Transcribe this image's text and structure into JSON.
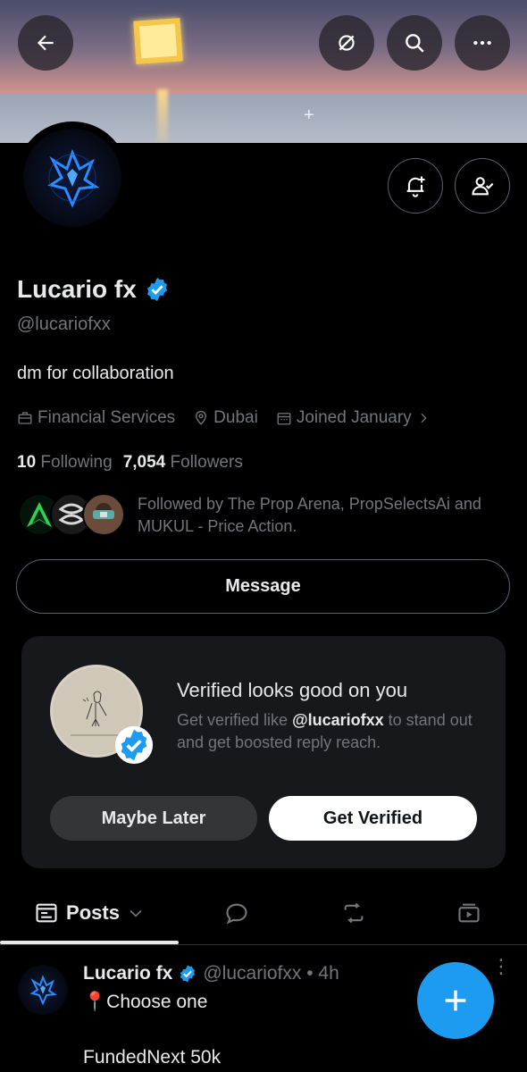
{
  "profile": {
    "name": "Lucario fx",
    "handle": "@lucariofxx",
    "bio": "dm for collaboration",
    "category": "Financial Services",
    "location": "Dubai",
    "joined": "Joined January",
    "following_count": "10",
    "following_label": "Following",
    "followers_count": "7,054",
    "followers_label": "Followers",
    "followed_by": "Followed by The Prop Arena, PropSelectsAi and MUKUL - Price Action.",
    "message_label": "Message"
  },
  "promo": {
    "title": "Verified looks good on you",
    "desc_prefix": "Get verified like ",
    "desc_handle": "@lucariofxx",
    "desc_suffix": " to stand out and get boosted reply reach.",
    "maybe_label": "Maybe Later",
    "get_label": "Get Verified"
  },
  "tabs": {
    "posts_label": "Posts"
  },
  "post": {
    "name": "Lucario fx",
    "handle_time": "@lucariofxx • 4h",
    "line1": "📍Choose one",
    "line2": "FundedNext 50k"
  },
  "colors": {
    "accent": "#1d9bf0",
    "background": "#000000",
    "muted": "#71767b"
  }
}
